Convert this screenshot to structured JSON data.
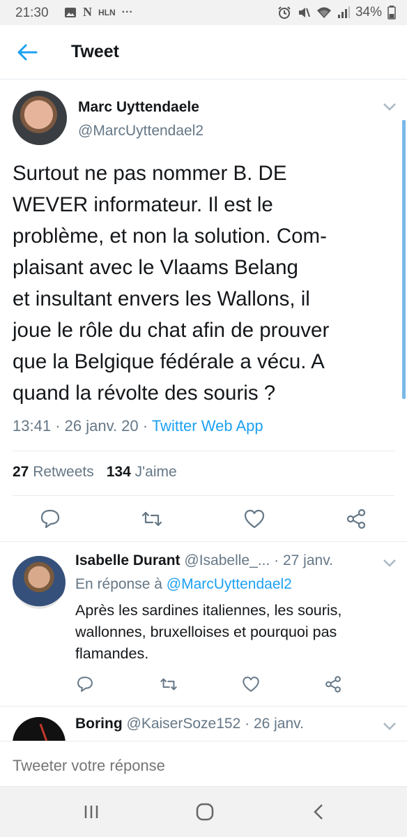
{
  "status_bar": {
    "time": "21:30",
    "left_icons": [
      "image-icon",
      "n-app-icon",
      "hln-icon",
      "more-dots-icon"
    ],
    "hln_text": "HLN",
    "n_text": "N",
    "dots_text": "···",
    "battery": "34%",
    "right_icons": [
      "alarm-icon",
      "mute-icon",
      "wifi-icon",
      "signal-icon"
    ]
  },
  "app_bar": {
    "title": "Tweet",
    "back_icon": "arrow-left-icon"
  },
  "tweet": {
    "author_name": "Marc Uyttendaele",
    "author_handle": "@MarcUyttendael2",
    "text": "Surtout ne pas nommer B. DE\nWEVER informateur. Il est le\nproblème, et non la solution.  Com-\nplaisant avec le Vlaams Belang\net insultant envers les Wallons, il\njoue le rôle du chat afin de prouver\nque la Belgique fédérale a vécu. A\nquand la révolte des souris ?",
    "time": "13:41",
    "date": "26 janv. 20",
    "separator": "·",
    "source": "Twitter Web App",
    "retweets_count": "27",
    "retweets_label": "Retweets",
    "likes_count": "134",
    "likes_label": "J'aime"
  },
  "replies": [
    {
      "name": "Isabelle Durant",
      "handle": "@Isabelle_...",
      "separator": "·",
      "date": "27 janv.",
      "reply_prefix": "En réponse à",
      "reply_to": "@MarcUyttendael2",
      "text": "Après les sardines italiennes, les souris,\nwallonnes, bruxelloises et pourquoi pas\nflamandes."
    },
    {
      "name": "Boring",
      "handle": "@KaiserSoze152",
      "separator": "·",
      "date": "26 janv."
    }
  ],
  "compose": {
    "placeholder": "Tweeter votre réponse"
  },
  "colors": {
    "accent": "#1da1f2",
    "text": "#14171a",
    "muted": "#657786",
    "divider": "#e6ecf0"
  }
}
